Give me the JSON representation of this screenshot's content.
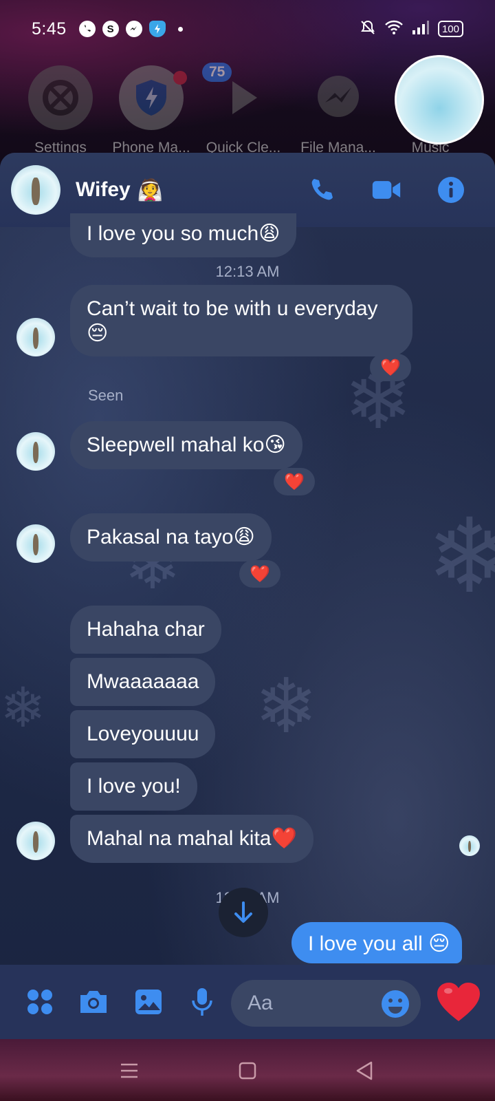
{
  "status_bar": {
    "time": "5:45",
    "app_icons": [
      "viber-icon",
      "skype-icon",
      "messenger-icon",
      "shield-icon"
    ],
    "battery": "100"
  },
  "dock": {
    "badge_count": "75",
    "apps": [
      {
        "label": "Settings",
        "icon": "gear-icon"
      },
      {
        "label": "Phone Ma...",
        "icon": "phone-manager-icon"
      },
      {
        "label": "Quick Cle...",
        "icon": "play-icon"
      },
      {
        "label": "File Mana...",
        "icon": "messenger-icon"
      },
      {
        "label": "Music",
        "icon": "music-icon"
      }
    ]
  },
  "chat": {
    "contact_name": "Wifey",
    "contact_emoji": "👰",
    "messages": [
      {
        "text": "I love you so much😩"
      },
      {
        "timestamp": "12:13 AM"
      },
      {
        "text": "Can’t wait to be with u everyday 😔",
        "reaction": "❤️"
      },
      {
        "status": "Seen"
      },
      {
        "text": "Sleepwell mahal ko😘",
        "reaction": "❤️"
      },
      {
        "text": "Pakasal na tayo😩",
        "reaction": "❤️"
      },
      {
        "text": "Hahaha char"
      },
      {
        "text": "Mwaaaaaaa"
      },
      {
        "text": "Loveyouuuu"
      },
      {
        "text": "I love you!"
      },
      {
        "text": "Mahal na mahal kita❤️"
      },
      {
        "timestamp": "12:__ AM"
      },
      {
        "text": "I love you all 😔"
      }
    ]
  },
  "composer": {
    "placeholder": "Aa",
    "like_emoji": "❤️"
  },
  "colors": {
    "accent": "#3e8df0",
    "bubble_incoming": "#3a4664",
    "header_bg": "#27335a",
    "reaction_heart": "#e8263a"
  }
}
